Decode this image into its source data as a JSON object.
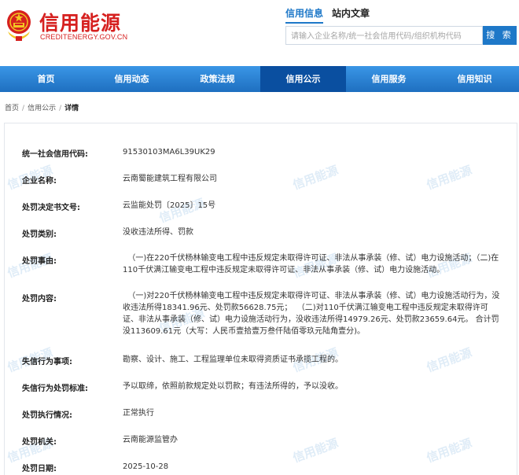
{
  "site": {
    "title": "信用能源",
    "domain": "CREDITENERGY.GOV.CN"
  },
  "search": {
    "tabs": [
      "信用信息",
      "站内文章"
    ],
    "placeholder": "请输入企业名称/统一社会信用代码/组织机构代码",
    "button_label": "搜 索"
  },
  "nav": {
    "items": [
      "首页",
      "信用动态",
      "政策法规",
      "信用公示",
      "信用服务",
      "信用知识"
    ],
    "active_index": 3
  },
  "breadcrumb": {
    "items": [
      "首页",
      "信用公示",
      "详情"
    ],
    "separator": "/"
  },
  "detail": {
    "watermark_text": "信用能源",
    "rows": [
      {
        "label": "统一社会信用代码:",
        "value": "91530103MA6L39UK29"
      },
      {
        "label": "企业名称:",
        "value": "云南蜀能建筑工程有限公司"
      },
      {
        "label": "处罚决定书文号:",
        "value": "云监能处罚〔2025〕15号"
      },
      {
        "label": "处罚类别:",
        "value": "没收违法所得、罚款"
      },
      {
        "label": "处罚事由:",
        "value": "  （一)在220千伏杨林输变电工程中违反规定未取得许可证、非法从事承装（修、试）电力设施活动；（二)在110千伏满江输变电工程中违反规定未取得许可证、非法从事承装（修、试）电力设施活动。"
      },
      {
        "label": "处罚内容:",
        "value": "  （一)对220千伏杨林输变电工程中违反规定未取得许可证、非法从事承装（修、试）电力设施活动行为，没收违法所得18341.96元、处罚款56628.75元；  （二)对110千伏满江输变电工程中违反规定未取得许可证、非法从事承装（修、试）电力设施活动行为，没收违法所得14979.26元、处罚款23659.64元。 合计罚没113609.61元（大写：人民币壹拾壹万叁仟陆佰零玖元陆角壹分)。"
      },
      {
        "label": "失信行为事项:",
        "value": "勘察、设计、施工、工程监理单位未取得资质证书承揽工程的。"
      },
      {
        "label": "失信行为处罚标准:",
        "value": "予以取缔，依照前款规定处以罚款；有违法所得的，予以没收。"
      },
      {
        "label": "处罚执行情况:",
        "value": "正常执行"
      },
      {
        "label": "处罚机关:",
        "value": "云南能源监管办"
      },
      {
        "label": "处罚日期:",
        "value": "2025-10-28"
      }
    ]
  },
  "colors": {
    "brand_red": "#d6201f",
    "accent_blue": "#1e78c8",
    "nav_active": "#0a4fa0"
  },
  "icons": {
    "logo": "national-emblem-icon"
  }
}
